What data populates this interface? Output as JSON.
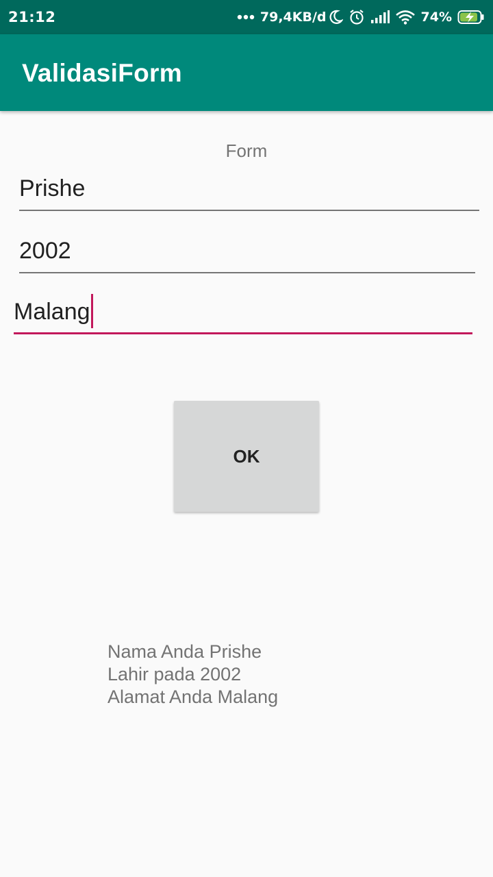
{
  "status_bar": {
    "time": "21:12",
    "network_speed": "79,4KB/d",
    "battery": "74%",
    "icons": [
      "more-dots-icon",
      "moon-icon",
      "alarm-icon",
      "signal-icon",
      "wifi-icon",
      "battery-charging-icon"
    ]
  },
  "app_bar": {
    "title": "ValidasiForm",
    "color": "#00897b"
  },
  "form": {
    "label": "Form",
    "name_value": "Prishe",
    "year_value": "2002",
    "address_value": "Malang",
    "accent_color": "#c2185b"
  },
  "ok_button": {
    "label": "OK"
  },
  "result": {
    "line1": "Nama Anda Prishe",
    "line2": "Lahir pada 2002",
    "line3": "Alamat Anda Malang"
  }
}
